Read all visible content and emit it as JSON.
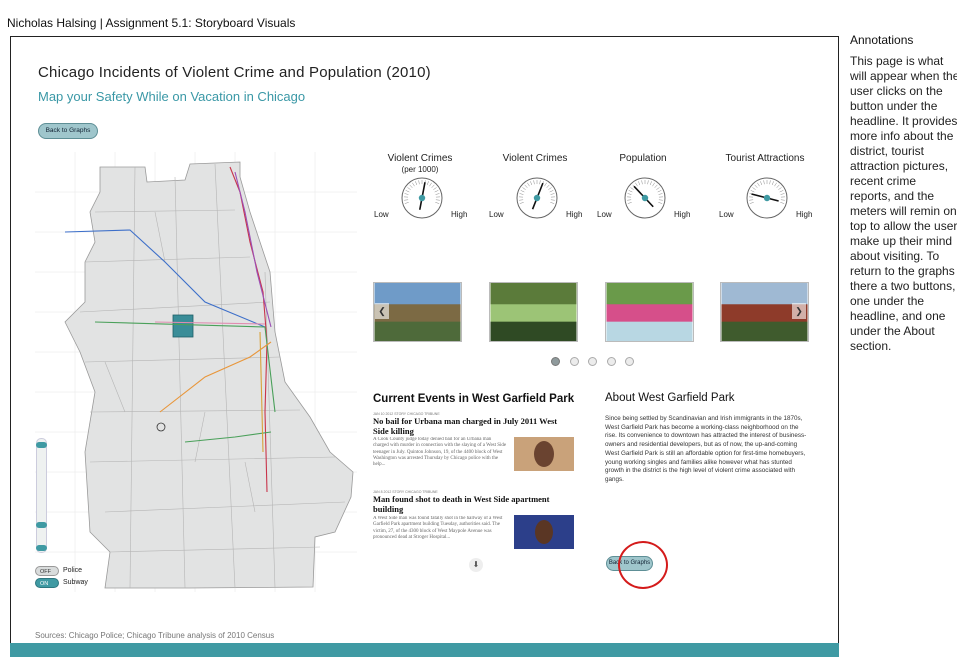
{
  "document_title": "Nicholas Halsing | Assignment 5.1: Storyboard Visuals",
  "page": {
    "title": "Chicago Incidents of Violent Crime and Population (2010)",
    "subtitle": "Map your Safety While on Vacation in Chicago",
    "back_button_label": "Back to Graphs",
    "sources": "Sources: Chicago Police; Chicago Tribune analysis of 2010 Census"
  },
  "map": {
    "zoom_in": "+",
    "zoom_out": "−",
    "toggles": [
      {
        "state": "OFF",
        "label": "Police"
      },
      {
        "state": "ON",
        "label": "Subway"
      }
    ]
  },
  "meters": [
    {
      "title": "Violent Crimes",
      "subtitle": "(per 1000)",
      "low": "Low",
      "high": "High",
      "level": 0.55
    },
    {
      "title": "Violent Crimes",
      "subtitle": "",
      "low": "Low",
      "high": "High",
      "level": 0.6
    },
    {
      "title": "Population",
      "subtitle": "",
      "low": "Low",
      "high": "High",
      "level": 0.3
    },
    {
      "title": "Tourist Attractions",
      "subtitle": "",
      "low": "Low",
      "high": "High",
      "level": 0.15
    }
  ],
  "gallery": {
    "photos": [
      "photo-conservatory-pond",
      "photo-greenhouse-interior",
      "photo-flower-garden",
      "photo-brick-houses"
    ],
    "page_count": 5,
    "active_page": 1,
    "prev": "❮",
    "next": "❯"
  },
  "news": {
    "heading": "Current Events in West Garfield Park",
    "items": [
      {
        "meta": "JAN 10 2012     STORY     CHICAGO TRIBUNE",
        "headline": "No bail for Urbana man charged in July 2011 West Side killing",
        "body": "A Cook County judge today denied bail for an Urbana man charged with murder in connection with the slaying of a West Side teenager in July. Quinton Johnson, 19, of the 4400 block of West Washington was arrested Thursday by Chicago police with the help..."
      },
      {
        "meta": "JAN 8 2012     STORY     CHICAGO TRIBUNE",
        "headline": "Man found shot to death in West Side apartment building",
        "body": "A West Side man was found fatally shot in the hallway of a West Garfield Park apartment building Tuesday, authorities said. The victim, 27, of the 4300 block of West Maypole Avenue was pronounced dead at Stroger Hospital..."
      }
    ],
    "more": "⬇"
  },
  "about": {
    "heading": "About West Garfield Park",
    "body": "Since being settled by Scandinavian and Irish immigrants in the 1870s, West Garfield Park has become a working-class neighborhood on the rise. Its convenience to downtown has attracted the interest of business-owners and residential developers, but as of now, the up-and-coming West Garfield Park is still an affordable option for first-time homebuyers, young working singles and families alike however what has stunted growth in the district is the high level of violent crime associated with gangs.",
    "back_button_label": "Back to Graphs"
  },
  "annotations": {
    "title": "Annotations",
    "body": "This page is what will appear when the user clicks on the button under the headline. It provides more info about the district, tourist attraction pictures, recent crime reports, and the meters will remin on top to allow the user make up their mind about visiting. To return to the graphs there a two buttons, one under the headline, and one under the About section."
  },
  "colors": {
    "accent": "#3f9aa3",
    "highlight_circle": "#d41b1b"
  }
}
